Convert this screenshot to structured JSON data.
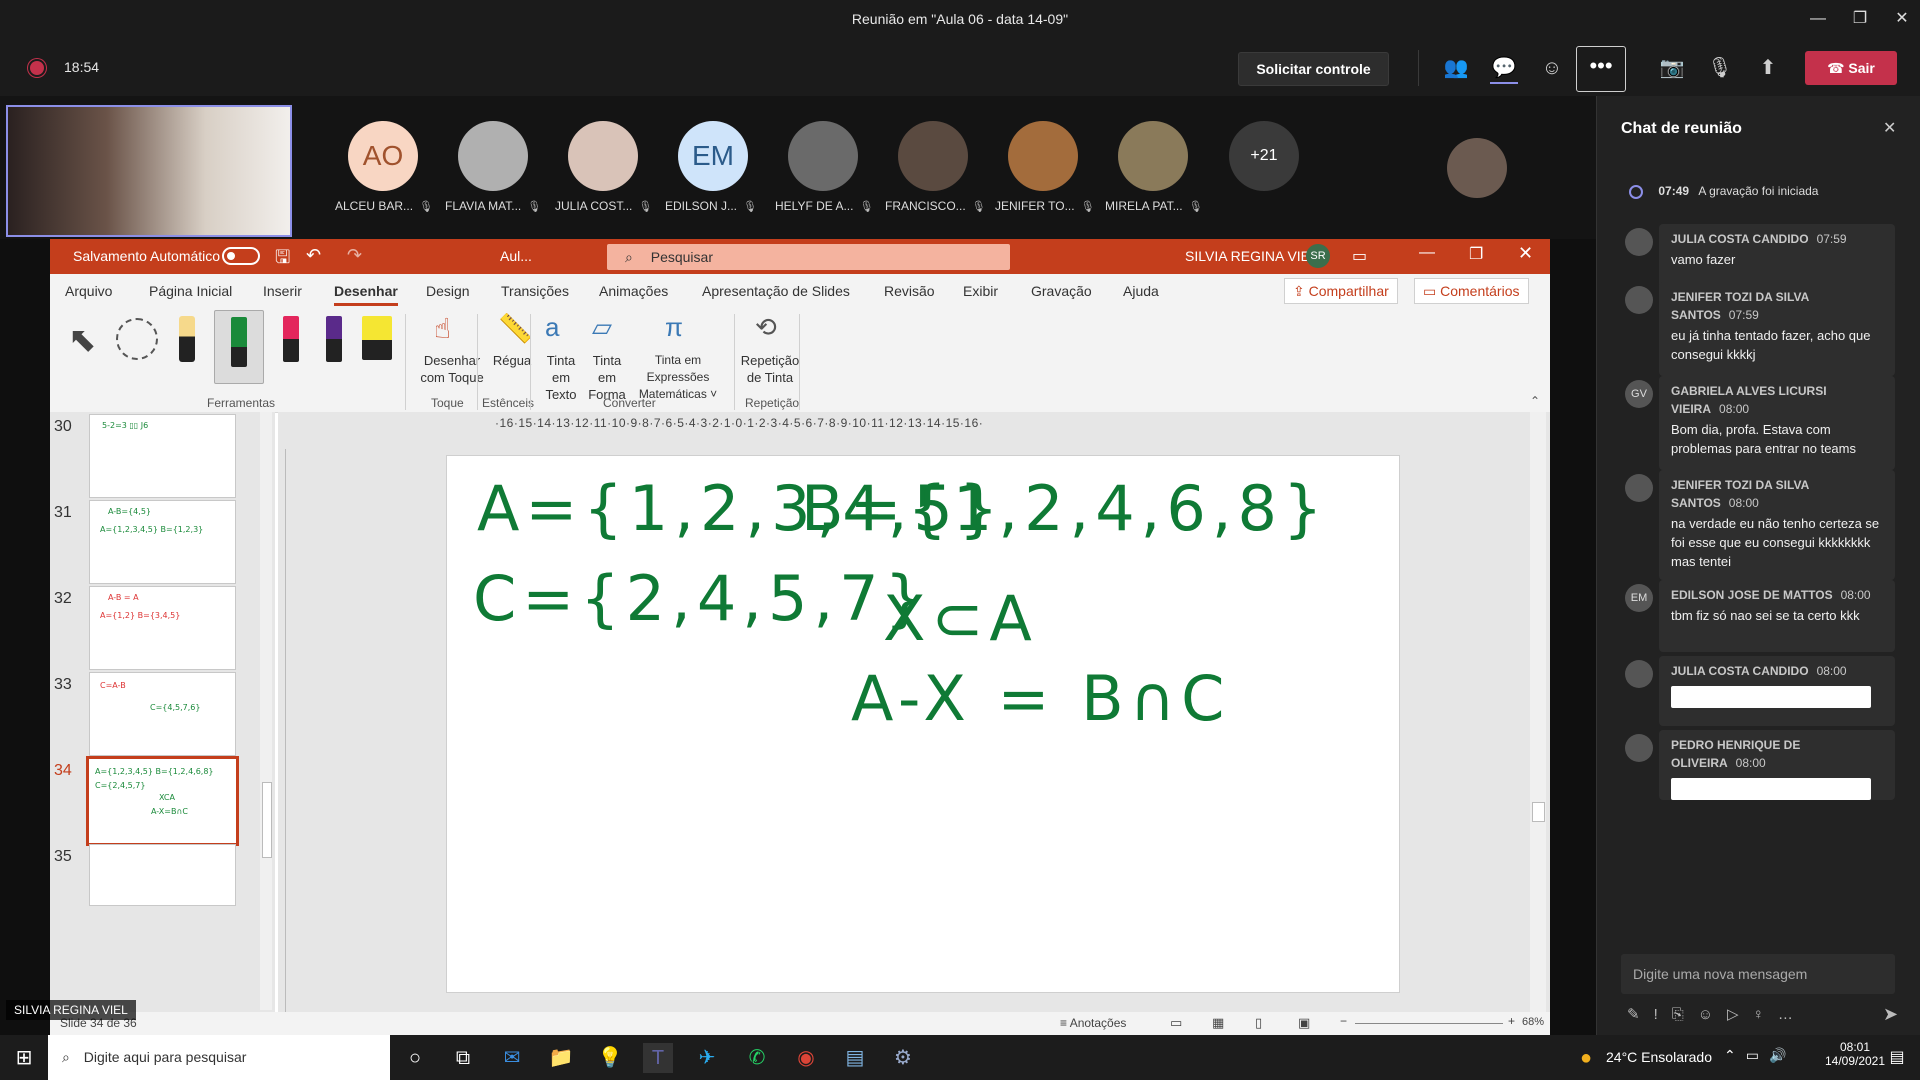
{
  "window": {
    "title": "Reunião em \"Aula 06 - data 14-09\""
  },
  "meeting": {
    "elapsed": "18:54",
    "request_control": "Solicitar controle",
    "leave": "Sair",
    "more": "•••"
  },
  "participants": [
    {
      "initials": "AO",
      "name": "ALCEU BAR...",
      "color": "#f8d6c3",
      "text_color": "#a0522d"
    },
    {
      "initials": "",
      "name": "FLAVIA MAT...",
      "color": "#b0b0b0"
    },
    {
      "initials": "",
      "name": "JULIA COST...",
      "color": "#d9c3b8"
    },
    {
      "initials": "EM",
      "name": "EDILSON J...",
      "color": "#cfe4fa",
      "text_color": "#2b5b8a"
    },
    {
      "initials": "",
      "name": "HELYF DE A...",
      "color": "#6a6a6a"
    },
    {
      "initials": "",
      "name": "FRANCISCO...",
      "color": "#5a4a40"
    },
    {
      "initials": "",
      "name": "JENIFER TO...",
      "color": "#a36c3c"
    },
    {
      "initials": "",
      "name": "MIRELA PAT...",
      "color": "#8a7a5a"
    }
  ],
  "more_participants": "+21",
  "self_label": "SILVIA REGINA VIEL",
  "ppt": {
    "autosave": "Salvamento Automático",
    "filename": "Aul...",
    "search_placeholder": "Pesquisar",
    "user": "SILVIA REGINA VIEL",
    "user_initials": "SR",
    "menu": [
      "Arquivo",
      "Página Inicial",
      "Inserir",
      "Desenhar",
      "Design",
      "Transições",
      "Animações",
      "Apresentação de Slides",
      "Revisão",
      "Exibir",
      "Gravação",
      "Ajuda"
    ],
    "share": "Compartilhar",
    "comments": "Comentários",
    "ribbon": {
      "ferramentas": "Ferramentas",
      "desenhar_toque_1": "Desenhar",
      "desenhar_toque_2": "com Toque",
      "toque": "Toque",
      "regua": "Régua",
      "estenceis": "Estênceis",
      "tinta_texto_1": "Tinta em",
      "tinta_texto_2": "Texto",
      "tinta_forma_1": "Tinta em",
      "tinta_forma_2": "Forma",
      "tinta_expr_1": "Tinta em Expressões",
      "tinta_expr_2": "Matemáticas ˅",
      "converter": "Converter",
      "repeticao_1": "Repetição",
      "repeticao_2": "de Tinta",
      "repeticao": "Repetição"
    },
    "slides": [
      "30",
      "31",
      "32",
      "33",
      "34",
      "35"
    ],
    "ruler": "·16·15·14·13·12·11·10·9·8·7·6·5·4·3·2·1·0·1·2·3·4·5·6·7·8·9·10·11·12·13·14·15·16·",
    "slide_lines": {
      "line1a": "A={1,2,3,4,5}",
      "line1b": "B={1,2,4,6,8}",
      "line2a": "C={2,4,5,7}",
      "line2b": "X⊂A",
      "line3": "A-X = B∩C"
    },
    "status": {
      "slide_info": "Slide 34 de 36",
      "notes": "Anotações",
      "zoom": "68%"
    }
  },
  "chat": {
    "title": "Chat de reunião",
    "system": {
      "time": "07:49",
      "text": "A gravação foi iniciada"
    },
    "messages": [
      {
        "initials": "",
        "name": "JULIA COSTA CANDIDO",
        "time": "07:59",
        "text": "vamo fazer"
      },
      {
        "initials": "",
        "name": "JENIFER TOZI DA SILVA SANTOS",
        "time": "07:59",
        "text": "eu já tinha tentado fazer, acho que consegui kkkkj"
      },
      {
        "initials": "GV",
        "name": "GABRIELA ALVES LICURSI VIEIRA",
        "time": "08:00",
        "text": "Bom dia, profa. Estava com problemas para entrar no teams"
      },
      {
        "initials": "",
        "name": "JENIFER TOZI DA SILVA SANTOS",
        "time": "08:00",
        "text": "na verdade eu não tenho certeza se foi esse que eu consegui kkkkkkkk mas tentei"
      },
      {
        "initials": "EM",
        "name": "EDILSON JOSE DE MATTOS",
        "time": "08:00",
        "text": "tbm fiz só nao sei se ta certo kkk"
      },
      {
        "initials": "",
        "name": "JULIA COSTA CANDIDO",
        "time": "08:00",
        "text": ""
      },
      {
        "initials": "",
        "name": "PEDRO HENRIQUE DE OLIVEIRA",
        "time": "08:00",
        "text": ""
      }
    ],
    "input_placeholder": "Digite uma nova mensagem"
  },
  "taskbar": {
    "search": "Digite aqui para pesquisar",
    "weather": "24°C  Ensolarado",
    "time": "08:01",
    "date": "14/09/2021"
  }
}
